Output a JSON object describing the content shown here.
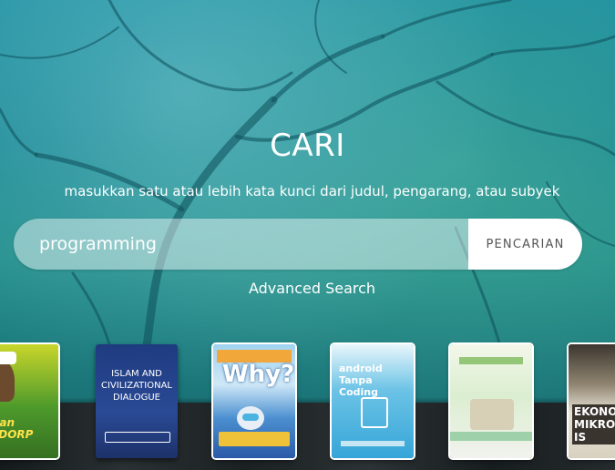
{
  "hero": {
    "title": "CARI",
    "subtitle": "masukkan satu atau lebih kata kunci dari judul, pengarang, atau subyek"
  },
  "search": {
    "value": "programming",
    "placeholder": "",
    "button_label": "PENCARIAN"
  },
  "advanced_search_label": "Advanced Search",
  "books": [
    {
      "title_text": "Ajaran KULDORP"
    },
    {
      "title_text": "ISLAM AND CIVILIZATIONAL DIALOGUE"
    },
    {
      "title_text": "Why?"
    },
    {
      "title_text": "android Tanpa Coding"
    },
    {
      "title_text": ""
    },
    {
      "title_text": "EKONOMI MIKRO IS"
    }
  ],
  "colors": {
    "accent": "#1f8fa0",
    "button_bg": "#ffffff",
    "button_text": "#555555"
  }
}
